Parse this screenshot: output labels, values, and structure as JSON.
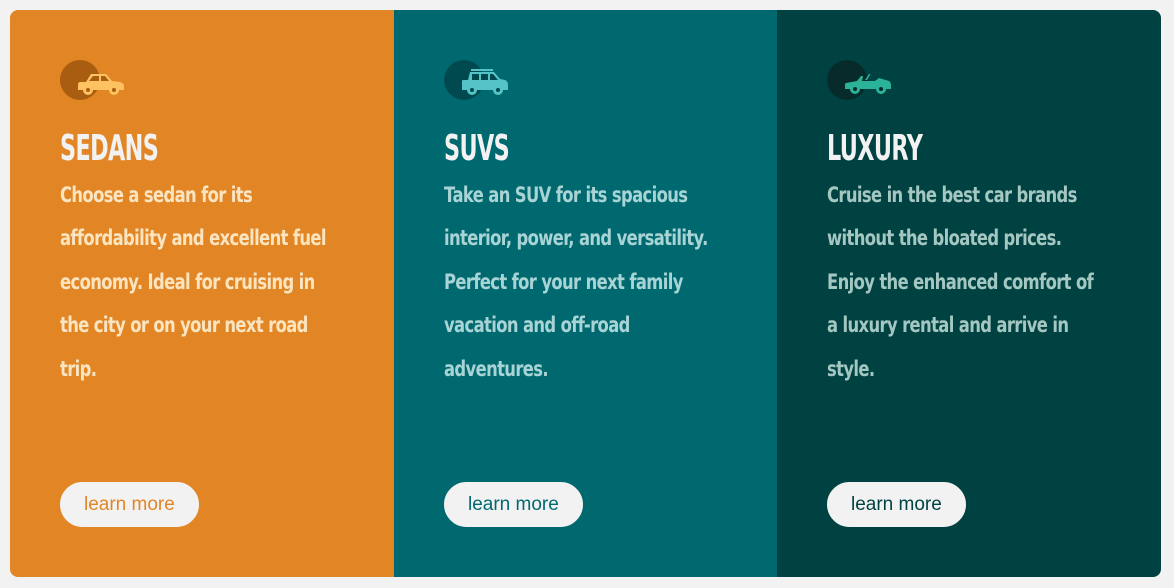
{
  "cards": [
    {
      "id": "sedans",
      "title": "SEDANS",
      "description": "Choose a sedan for its affordability and excellent fuel economy. Ideal for cruising in the city or on your next road trip.",
      "button_label": "learn more",
      "icon": "sedan-car-icon",
      "background_color": "#e28625",
      "icon_circle_color": "#a95d10",
      "icon_color": "#ffc262",
      "button_text_color": "#e28625"
    },
    {
      "id": "suvs",
      "title": "SUVS",
      "description": "Take an SUV for its spacious interior, power, and versatility. Perfect for your next family vacation and off-road adventures.",
      "button_label": "learn more",
      "icon": "suv-car-icon",
      "background_color": "#006970",
      "icon_circle_color": "#004a4f",
      "icon_color": "#56c3c8",
      "button_text_color": "#006970"
    },
    {
      "id": "luxury",
      "title": "LUXURY",
      "description": "Cruise in the best car brands without the bloated prices. Enjoy the enhanced comfort of a luxury rental and arrive in style.",
      "button_label": "learn more",
      "icon": "luxury-convertible-car-icon",
      "background_color": "#004241",
      "icon_circle_color": "#062b2a",
      "icon_color": "#2bb39a",
      "button_text_color": "#004241"
    }
  ]
}
